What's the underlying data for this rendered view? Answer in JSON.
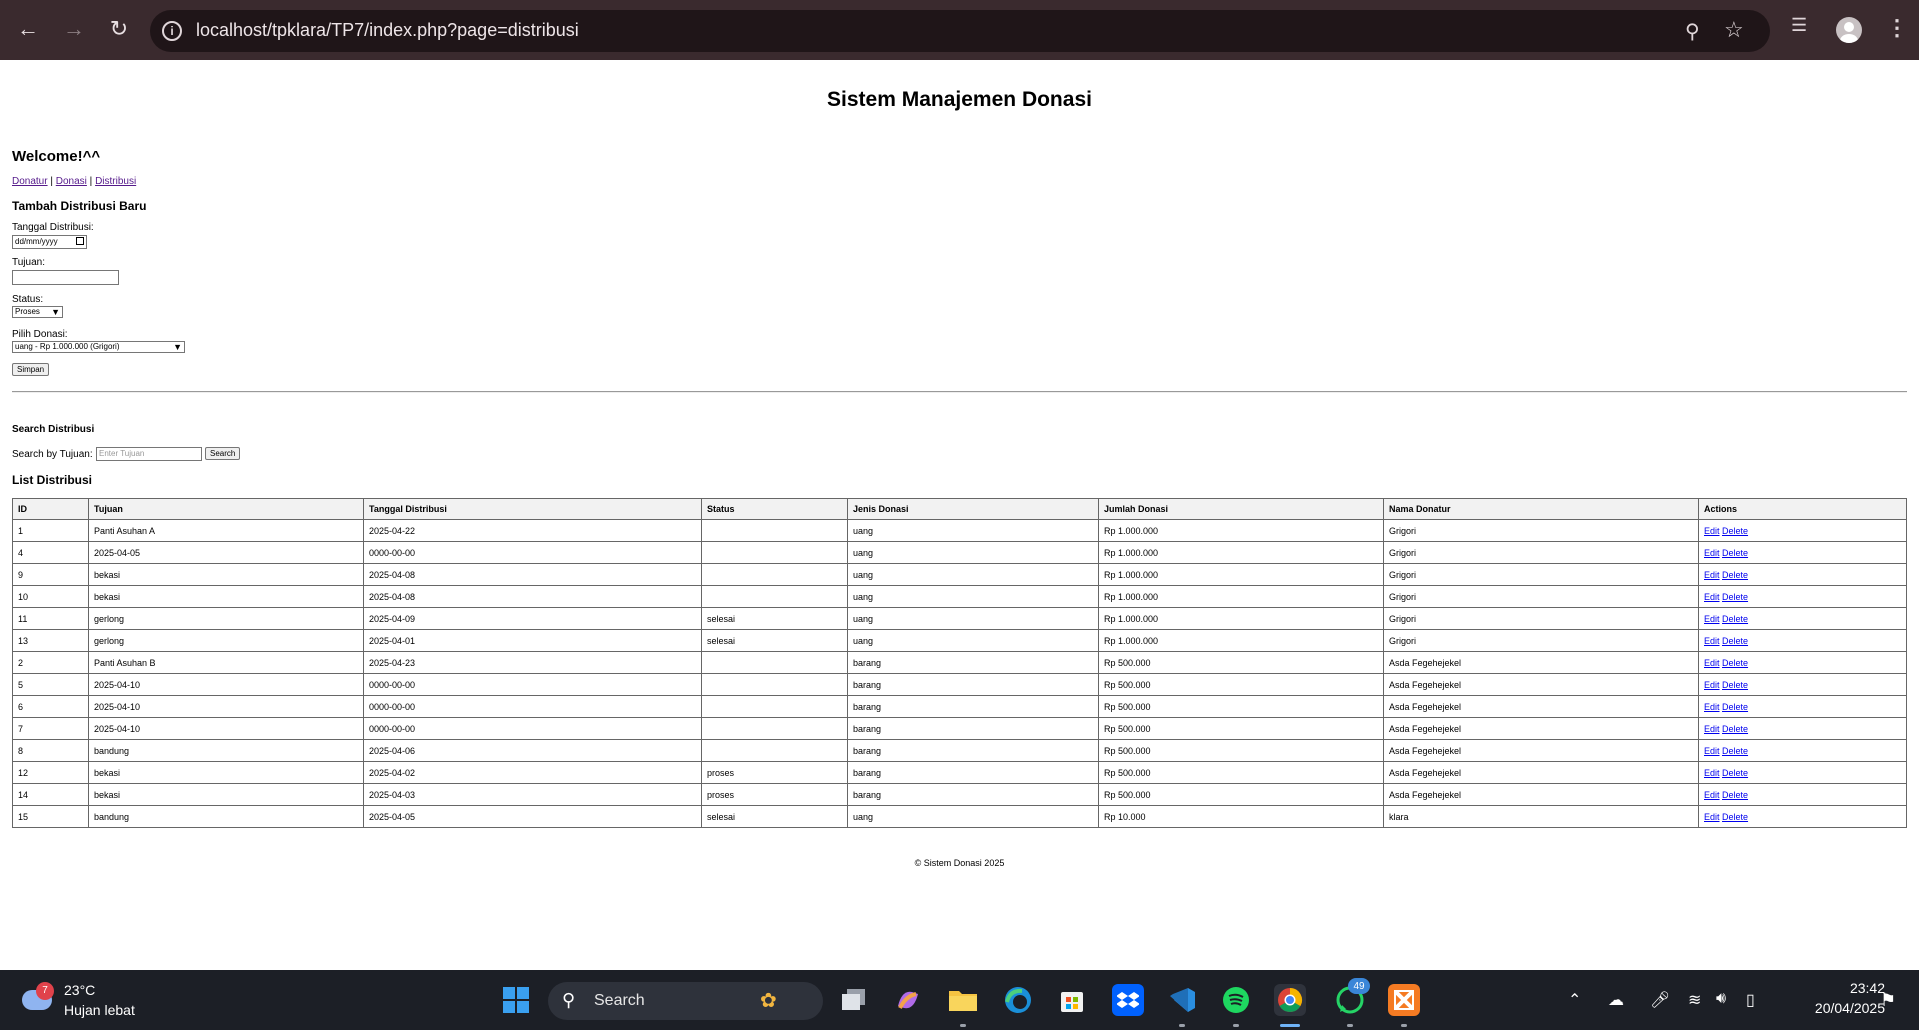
{
  "browser": {
    "url": "localhost/tpklara/TP7/index.php?page=distribusi"
  },
  "page": {
    "title": "Sistem Manajemen Donasi",
    "welcome": "Welcome!^^",
    "nav": [
      {
        "label": "Donatur"
      },
      {
        "label": "Donasi"
      },
      {
        "label": "Distribusi"
      }
    ],
    "nav_separator": "|",
    "form": {
      "title": "Tambah Distribusi Baru",
      "tanggal_label": "Tanggal Distribusi:",
      "tanggal_placeholder": "dd/mm/yyyy",
      "tujuan_label": "Tujuan:",
      "tujuan_value": "",
      "status_label": "Status:",
      "status_value": "Proses",
      "donasi_label": "Pilih Donasi:",
      "donasi_value": "uang - Rp 1.000.000 (Grigori)",
      "submit_label": "Simpan"
    },
    "search": {
      "title": "Search Distribusi",
      "label": "Search by Tujuan:",
      "placeholder": "Enter Tujuan",
      "button_label": "Search"
    },
    "list_title": "List Distribusi",
    "table": {
      "headers": [
        "ID",
        "Tujuan",
        "Tanggal Distribusi",
        "Status",
        "Jenis Donasi",
        "Jumlah Donasi",
        "Nama Donatur",
        "Actions"
      ],
      "edit_label": "Edit",
      "delete_label": "Delete",
      "rows": [
        {
          "id": "1",
          "tujuan": "Panti Asuhan A",
          "tanggal": "2025-04-22",
          "status": "",
          "jenis": "uang",
          "jumlah": "Rp 1.000.000",
          "donatur": "Grigori"
        },
        {
          "id": "4",
          "tujuan": "2025-04-05",
          "tanggal": "0000-00-00",
          "status": "",
          "jenis": "uang",
          "jumlah": "Rp 1.000.000",
          "donatur": "Grigori"
        },
        {
          "id": "9",
          "tujuan": "bekasi",
          "tanggal": "2025-04-08",
          "status": "",
          "jenis": "uang",
          "jumlah": "Rp 1.000.000",
          "donatur": "Grigori"
        },
        {
          "id": "10",
          "tujuan": "bekasi",
          "tanggal": "2025-04-08",
          "status": "",
          "jenis": "uang",
          "jumlah": "Rp 1.000.000",
          "donatur": "Grigori"
        },
        {
          "id": "11",
          "tujuan": "gerlong",
          "tanggal": "2025-04-09",
          "status": "selesai",
          "jenis": "uang",
          "jumlah": "Rp 1.000.000",
          "donatur": "Grigori"
        },
        {
          "id": "13",
          "tujuan": "gerlong",
          "tanggal": "2025-04-01",
          "status": "selesai",
          "jenis": "uang",
          "jumlah": "Rp 1.000.000",
          "donatur": "Grigori"
        },
        {
          "id": "2",
          "tujuan": "Panti Asuhan B",
          "tanggal": "2025-04-23",
          "status": "",
          "jenis": "barang",
          "jumlah": "Rp 500.000",
          "donatur": "Asda Fegehejekel"
        },
        {
          "id": "5",
          "tujuan": "2025-04-10",
          "tanggal": "0000-00-00",
          "status": "",
          "jenis": "barang",
          "jumlah": "Rp 500.000",
          "donatur": "Asda Fegehejekel"
        },
        {
          "id": "6",
          "tujuan": "2025-04-10",
          "tanggal": "0000-00-00",
          "status": "",
          "jenis": "barang",
          "jumlah": "Rp 500.000",
          "donatur": "Asda Fegehejekel"
        },
        {
          "id": "7",
          "tujuan": "2025-04-10",
          "tanggal": "0000-00-00",
          "status": "",
          "jenis": "barang",
          "jumlah": "Rp 500.000",
          "donatur": "Asda Fegehejekel"
        },
        {
          "id": "8",
          "tujuan": "bandung",
          "tanggal": "2025-04-06",
          "status": "",
          "jenis": "barang",
          "jumlah": "Rp 500.000",
          "donatur": "Asda Fegehejekel"
        },
        {
          "id": "12",
          "tujuan": "bekasi",
          "tanggal": "2025-04-02",
          "status": "proses",
          "jenis": "barang",
          "jumlah": "Rp 500.000",
          "donatur": "Asda Fegehejekel"
        },
        {
          "id": "14",
          "tujuan": "bekasi",
          "tanggal": "2025-04-03",
          "status": "proses",
          "jenis": "barang",
          "jumlah": "Rp 500.000",
          "donatur": "Asda Fegehejekel"
        },
        {
          "id": "15",
          "tujuan": "bandung",
          "tanggal": "2025-04-05",
          "status": "selesai",
          "jenis": "uang",
          "jumlah": "Rp 10.000",
          "donatur": "klara"
        }
      ]
    },
    "footer": "© Sistem Donasi 2025"
  },
  "taskbar": {
    "weather_badge": "7",
    "temperature": "23°C",
    "condition": "Hujan lebat",
    "search_label": "Search",
    "whatsapp_badge": "49",
    "time": "23:42",
    "date": "20/04/2025",
    "apps": [
      "windows-start",
      "task-view",
      "copilot",
      "file-explorer",
      "edge",
      "microsoft-store",
      "dropbox",
      "vscode",
      "spotify",
      "chrome",
      "whatsapp",
      "xampp"
    ]
  },
  "colors": {
    "chrome_bg": "#3a2a2e",
    "taskbar_bg": "#1c1f26",
    "link_visited": "#551a8b",
    "link": "#0000ee"
  }
}
